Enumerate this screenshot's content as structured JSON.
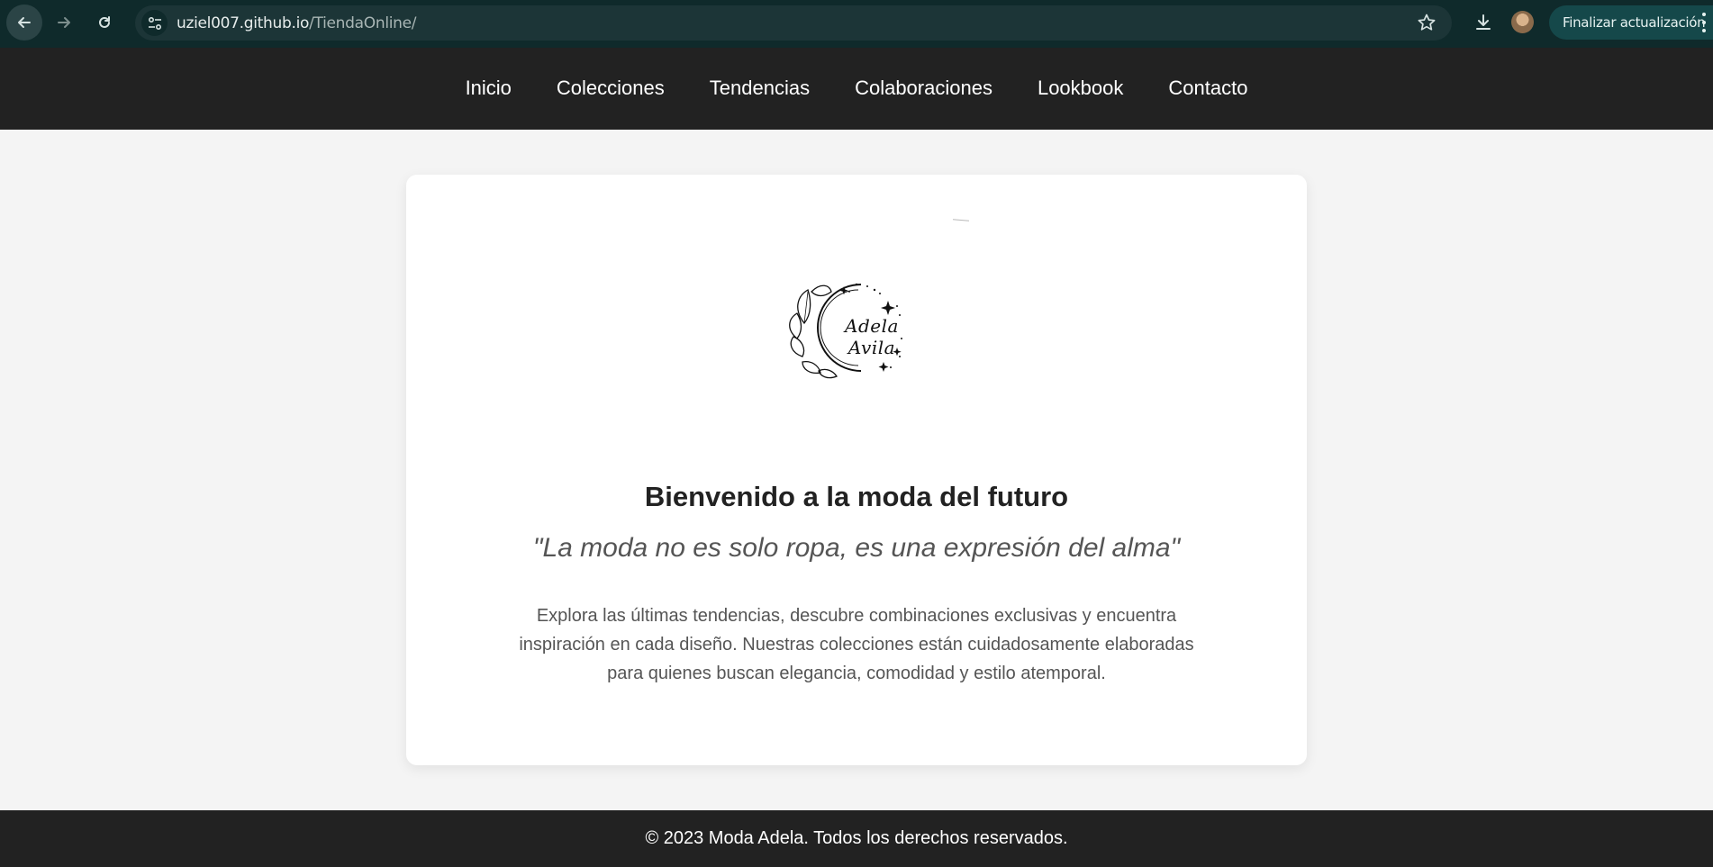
{
  "browser": {
    "url_host": "uziel007.github.io",
    "url_path": "/TiendaOnline/",
    "update_button": "Finalizar actualización"
  },
  "nav": {
    "items": [
      {
        "label": "Inicio"
      },
      {
        "label": "Colecciones"
      },
      {
        "label": "Tendencias"
      },
      {
        "label": "Colaboraciones"
      },
      {
        "label": "Lookbook"
      },
      {
        "label": "Contacto"
      }
    ]
  },
  "hero": {
    "logo_text": "Adela Avila",
    "headline": "Bienvenido a la moda del futuro",
    "quote": "\"La moda no es solo ropa, es una expresión del alma\"",
    "description": "Explora las últimas tendencias, descubre combinaciones exclusivas y encuentra inspiración en cada diseño. Nuestras colecciones están cuidadosamente elaboradas para quienes buscan elegancia, comodidad y estilo atemporal."
  },
  "footer": {
    "text": "© 2023 Moda Adela. Todos los derechos reservados."
  },
  "colors": {
    "chrome_bg": "#0f2a2b",
    "nav_bg": "#222222",
    "page_bg": "#f4f4f4",
    "card_bg": "#ffffff"
  }
}
